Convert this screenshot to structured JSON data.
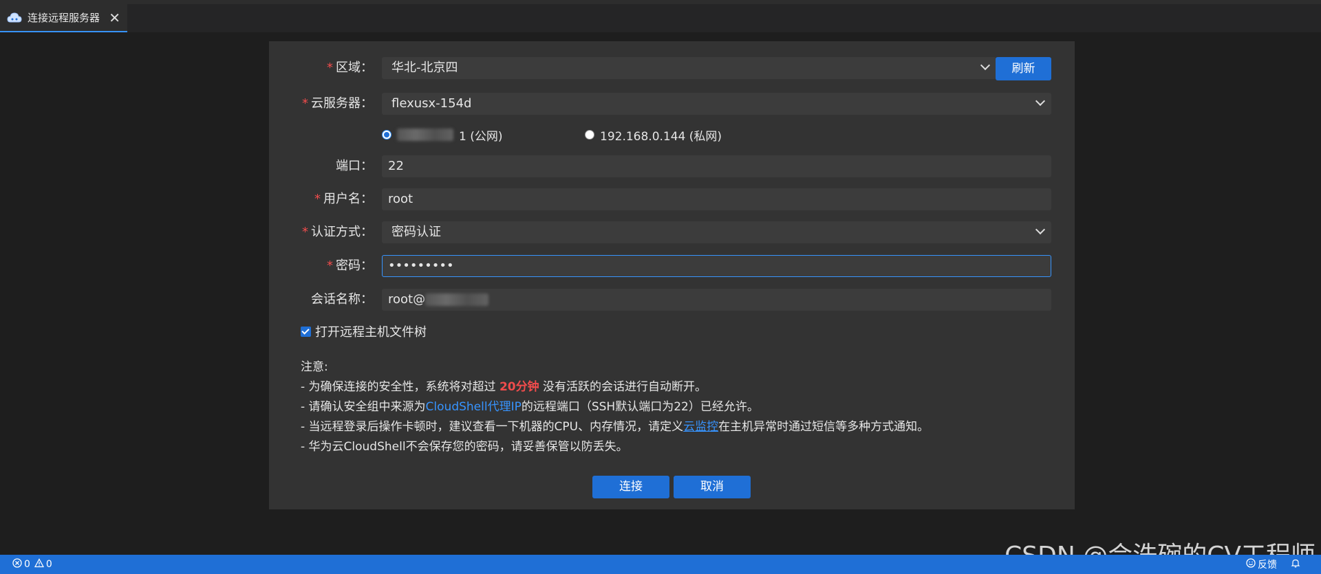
{
  "tab": {
    "label": "连接远程服务器",
    "close": "✕"
  },
  "form": {
    "region": {
      "label": "区域：",
      "value": "华北-北京四",
      "refresh": "刷新"
    },
    "server": {
      "label": "云服务器：",
      "value": "flexusx-154d"
    },
    "ip_options": [
      {
        "suffix": "1 (公网)",
        "checked": true
      },
      {
        "value": "192.168.0.144 (私网)",
        "checked": false
      }
    ],
    "port": {
      "label": "端口：",
      "value": "22"
    },
    "username": {
      "label": "用户名：",
      "value": "root"
    },
    "auth": {
      "label": "认证方式：",
      "value": "密码认证"
    },
    "password": {
      "label": "密码：",
      "value": "•••••••••"
    },
    "session": {
      "label": "会话名称：",
      "prefix": "root@"
    },
    "filetree": {
      "label": "打开远程主机文件树",
      "checked": true
    }
  },
  "notes": {
    "title": "注意:",
    "line1_a": "- 为确保连接的安全性，系统将对超过 ",
    "line1_red": "20分钟",
    "line1_b": " 没有活跃的会话进行自动断开。",
    "line2_a": "- 请确认安全组中来源为",
    "line2_link": "CloudShell代理IP",
    "line2_b": "的远程端口（SSH默认端口为22）已经允许。",
    "line3_a": "- 当远程登录后操作卡顿时，建议查看一下机器的CPU、内存情况，请定义",
    "line3_link": "云监控",
    "line3_b": "在主机异常时通过短信等多种方式通知。",
    "line4": "- 华为云CloudShell不会保存您的密码，请妥善保管以防丢失。"
  },
  "buttons": {
    "connect": "连接",
    "cancel": "取消"
  },
  "status": {
    "errors": "0",
    "warnings": "0",
    "feedback": "反馈"
  },
  "watermark": "CSDN @会洗碗的CV工程师",
  "colors": {
    "accent": "#1f6fd6",
    "required": "#f14c4c",
    "link": "#3794ff"
  }
}
